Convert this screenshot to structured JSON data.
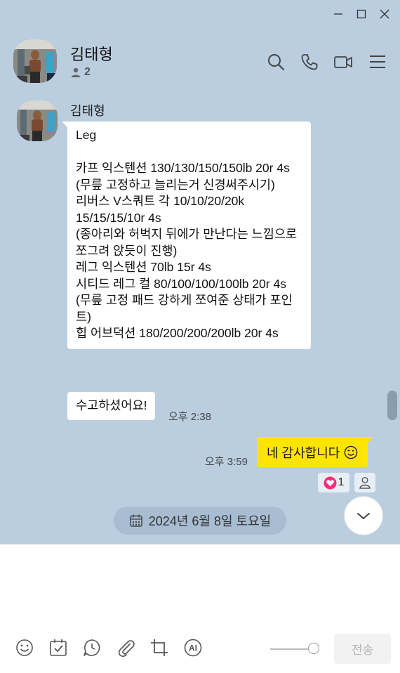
{
  "header": {
    "chat_name": "김태형",
    "member_count": "2"
  },
  "messages": {
    "sender_name": "김태형",
    "main_text": "Leg\n\n카프 익스텐션 130/130/150/150lb 20r 4s\n(무릎 고정하고 늘리는거 신경써주시기)\n리버스 V스쿼트 각 10/10/20/20k 15/15/15/10r 4s\n(종아리와 허벅지 뒤에가 만난다는 느낌으로 쪼그려 앉듯이 진행)\n레그 익스텐션 70lb 15r 4s\n시티드 레그 컬 80/100/100/100lb 20r 4s\n(무릎 고정 패드 강하게 쪼여준 상태가 포인트)\n힙 어브덕션 180/200/200/200lb 20r 4s",
    "second_text": "수고하셨어요!",
    "received_time": "오후 2:38",
    "mine_text": "네 감사합니다",
    "mine_emoji": "😉",
    "sent_time": "오후 3:59",
    "heart_reaction_count": "1"
  },
  "date_divider": "2024년 6월 8일 토요일",
  "composer": {
    "placeholder": "",
    "send_label": "전송"
  },
  "icons": [
    "minimize-icon",
    "maximize-icon",
    "close-icon",
    "search-icon",
    "phone-icon",
    "video-icon",
    "menu-icon",
    "person-icon",
    "calendar-icon",
    "heart-icon",
    "chevron-down-icon",
    "emoji-icon",
    "schedule-icon",
    "clock-icon",
    "attach-icon",
    "crop-icon",
    "ai-icon"
  ],
  "colors": {
    "background": "#bacee0",
    "my_bubble": "#fee500",
    "heart": "#ff2d78"
  }
}
